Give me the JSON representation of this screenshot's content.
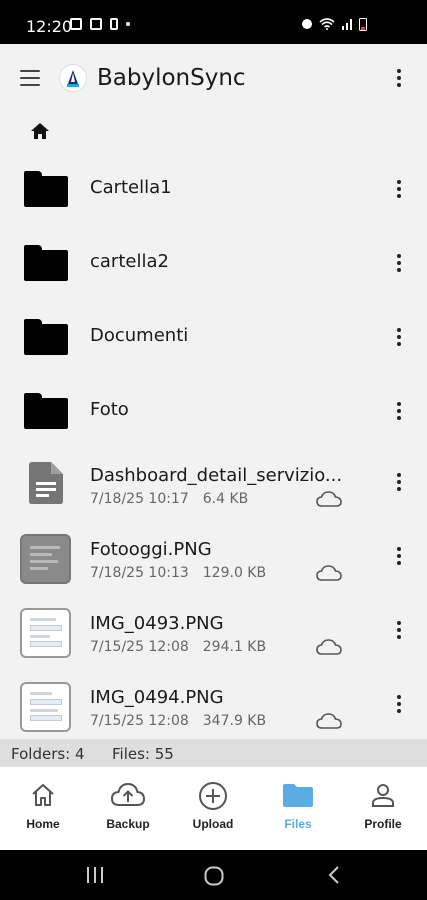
{
  "status_bar": {
    "time": "12:20"
  },
  "appbar": {
    "title": "BabylonSync",
    "menu_icon": "hamburger-menu-icon",
    "more_icon": "more-vert-icon"
  },
  "breadcrumb": {
    "icon": "home-icon"
  },
  "folders": [
    {
      "name": "Cartella1"
    },
    {
      "name": "cartella2"
    },
    {
      "name": "Documenti"
    },
    {
      "name": "Foto"
    }
  ],
  "files": [
    {
      "name": "Dashboard_detail_servizio...",
      "date": "7/18/25 10:17",
      "size": "6.4 KB",
      "thumb": "document-icon"
    },
    {
      "name": "Fotooggi.PNG",
      "date": "7/18/25 10:13",
      "size": "129.0 KB",
      "thumb": "gray-screenshot"
    },
    {
      "name": "IMG_0493.PNG",
      "date": "7/15/25 12:08",
      "size": "294.1 KB",
      "thumb": "screen-screenshot"
    },
    {
      "name": "IMG_0494.PNG",
      "date": "7/15/25 12:08",
      "size": "347.9 KB",
      "thumb": "screen-screenshot"
    }
  ],
  "summary": {
    "folders": "Folders: 4",
    "files": "Files: 55"
  },
  "bottom_nav": [
    {
      "label": "Home",
      "icon": "home-outline-icon"
    },
    {
      "label": "Backup",
      "icon": "cloud-upload-icon"
    },
    {
      "label": "Upload",
      "icon": "add-circle-icon"
    },
    {
      "label": "Files",
      "icon": "folder-icon",
      "active": true
    },
    {
      "label": "Profile",
      "icon": "person-icon"
    }
  ],
  "colors": {
    "active": "#5aace4",
    "background": "#f2f2f2"
  }
}
